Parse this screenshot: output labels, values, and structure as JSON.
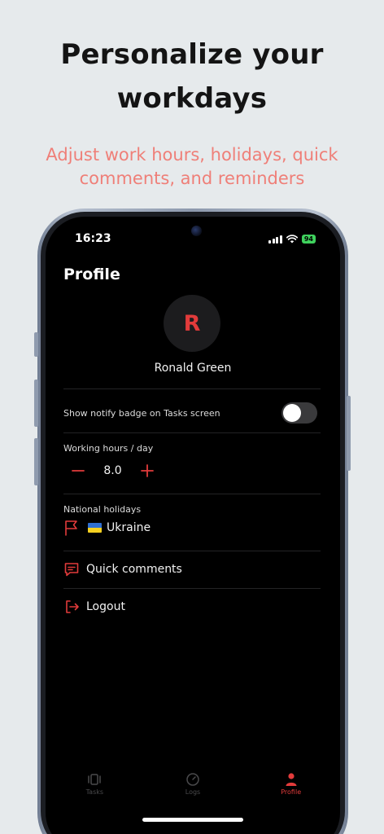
{
  "headline": [
    "Personalize your",
    "workdays"
  ],
  "subheadline": [
    "Adjust work hours, holidays, quick",
    "comments, and reminders"
  ],
  "status_bar": {
    "time": "16:23",
    "battery": "94"
  },
  "profile": {
    "title": "Profile",
    "avatar_initial": "R",
    "name": "Ronald Green",
    "notify_badge_label": "Show notify badge on Tasks screen",
    "notify_badge_enabled": false,
    "working_hours": {
      "label": "Working hours / day",
      "value": "8.0"
    },
    "holidays": {
      "label": "National holidays",
      "country": "Ukraine"
    },
    "quick_comments_label": "Quick comments",
    "logout_label": "Logout"
  },
  "tabs": [
    {
      "label": "Tasks",
      "icon": "tasks-icon",
      "active": false
    },
    {
      "label": "Logs",
      "icon": "logs-icon",
      "active": false
    },
    {
      "label": "Profile",
      "icon": "person-icon",
      "active": true
    }
  ],
  "colors": {
    "accent": "#e23b3b",
    "subheadline": "#ef7f78",
    "background": "#e6eaec"
  }
}
